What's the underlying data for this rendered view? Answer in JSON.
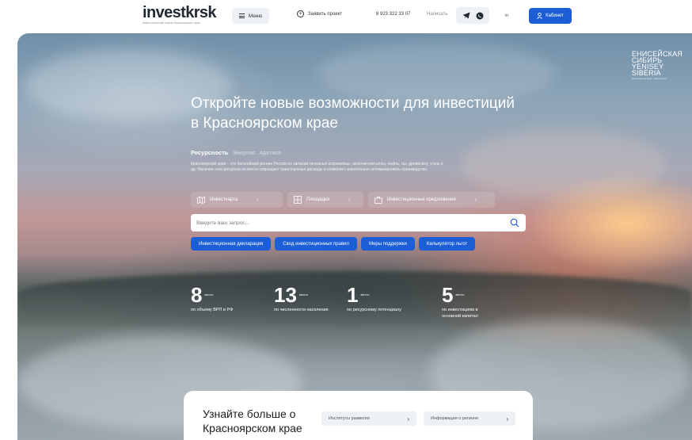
{
  "header": {
    "logo": "investkrsk",
    "logo_sub": "инвестиционный портал Красноярского края",
    "menu": "Меню",
    "apply": "Заявить проект",
    "phone": "8 923 322 33 07",
    "write": "Написать",
    "lang": "пг",
    "cabinet": "Кабинет"
  },
  "hero": {
    "brand_line1": "ЕНИСЕЙСКАЯ",
    "brand_line2": "СИБИРЬ",
    "brand_line3": "YENISEY",
    "brand_line4": "SIBERIA",
    "brand_small": "Красноярский край · Инвестиции",
    "title": "Откройте новые возможности для инвестиций в Красноярском крае",
    "tabs": [
      "Ресурсность",
      "Энергия",
      "Арктика"
    ],
    "description": "Красноярский край – это богатейший регион России по запасам полезных ископаемых, включая металлы, нефть, газ, древесину, уголь и др. Наличие этих ресурсов на месте сокращает транспортные расходы и позволяет значительно оптимизировать производство.",
    "quicklinks": [
      "Инвесткарта",
      "Площадки",
      "Инвестиционные предложения"
    ],
    "search_placeholder": "Введите ваш запрос...",
    "chips": [
      "Инвестиционная декларация",
      "Свод инвестиционных правил",
      "Меры поддержки",
      "Калькулятор льгот"
    ],
    "stats": [
      {
        "value": "8",
        "unit": "место",
        "label": "по объему ВРП в РФ"
      },
      {
        "value": "13",
        "unit": "место",
        "label": "по численности населения"
      },
      {
        "value": "1",
        "unit": "место",
        "label": "по ресурсному потенциалу"
      },
      {
        "value": "5",
        "unit": "место",
        "label": "по инвестициям в основной капитал"
      }
    ]
  },
  "card": {
    "title": "Узнайте больше о Красноярском крае",
    "links": [
      "Институты развития",
      "Информация о регионе"
    ]
  },
  "colors": {
    "accent": "#1c5ed6",
    "chip_bg": "#edf0f4"
  }
}
